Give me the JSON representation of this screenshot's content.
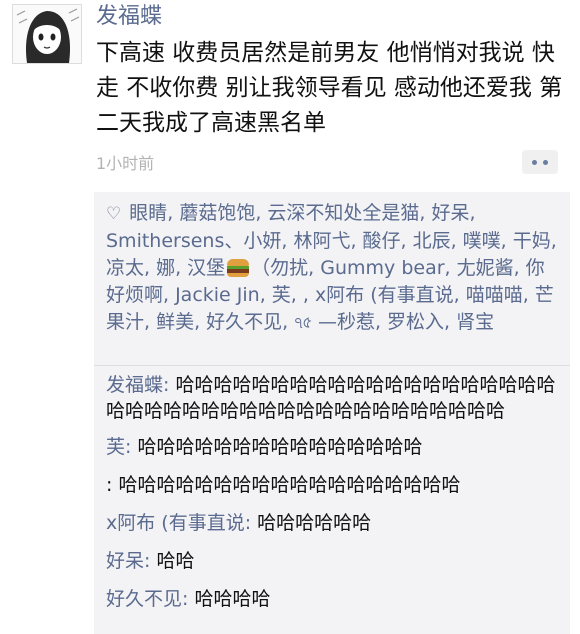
{
  "post": {
    "author": "发福蝶",
    "text": "下高速 收费员居然是前男友 他悄悄对我说 快走 不收你费 别让我领导看见 感动他还爱我 第二天我成了高速黑名单",
    "time": "1小时前"
  },
  "likes": {
    "icon": "heart-outline-icon",
    "text_before": "眼睛, 蘑菇饱饱, 云深不知处全是猫, 好呆, Smithersens、小妍, 林阿弋, 酸仔, 北辰, 噗噗, 干妈, 凉太, 娜, 汉堡",
    "burger_icon": "hamburger-emoji-icon",
    "text_after": "（勿扰, Gummy bear, 尢妮酱, 你好烦啊, Jackie Jin, 芙, , x阿布 (有事直说, 喵喵喵, 芒果汁, 鲜美, 好久不见, ঀ৫ —秒惹, 罗松入, 肾宝"
  },
  "comments": [
    {
      "name": "发福蝶",
      "sep": ": ",
      "text": "哈哈哈哈哈哈哈哈哈哈哈哈哈哈哈哈哈哈哈哈哈哈哈哈哈哈哈哈哈哈哈哈哈哈哈哈哈哈哈哈哈"
    },
    {
      "name": "芙",
      "sep": ": ",
      "text": "哈哈哈哈哈哈哈哈哈哈哈哈哈哈哈"
    },
    {
      "name": "",
      "sep": ": ",
      "text": "哈哈哈哈哈哈哈哈哈哈哈哈哈哈哈哈哈哈"
    },
    {
      "name": "x阿布 (有事直说",
      "sep": ": ",
      "text": "哈哈哈哈哈哈"
    },
    {
      "name": "好呆",
      "sep": ": ",
      "text": "哈哈"
    },
    {
      "name": "好久不见",
      "sep": ": ",
      "text": "哈哈哈哈"
    }
  ],
  "colors": {
    "name_link": "#5b6b8f",
    "panel_bg": "#f3f3f5",
    "time": "#b3b3b3"
  }
}
